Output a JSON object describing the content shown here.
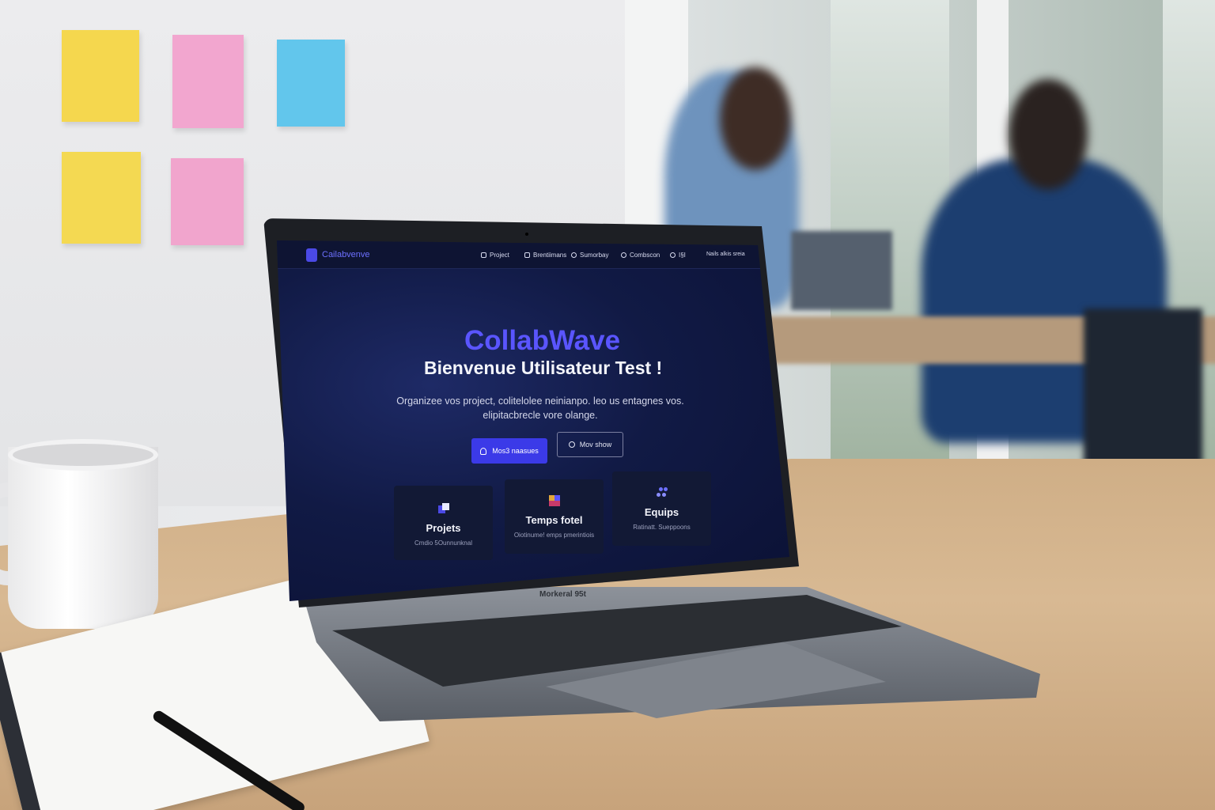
{
  "app": {
    "logo_text": "Cailabvenve",
    "brand_color": "#4b49e6"
  },
  "nav": {
    "items": [
      {
        "label": "Project",
        "icon": "user-icon"
      },
      {
        "label": "Brentiimans",
        "icon": "document-icon"
      },
      {
        "label": "Sumorbay",
        "icon": "search-icon"
      },
      {
        "label": "Combscon",
        "icon": "gear-icon"
      },
      {
        "label": "I§I",
        "icon": "search-icon"
      }
    ],
    "user_label": "Nails alkis sreia"
  },
  "hero": {
    "title": "CollabWave",
    "welcome": "Bienvenue Utilisateur Test !",
    "subtitle": "Organizee vos project, colitelolee neinianpo. leo us entagnes vos. elipitacbrecle vore olange.",
    "primary_button": "Mos3 naasues",
    "secondary_button": "Mov show"
  },
  "cards": [
    {
      "title": "Projets",
      "subtitle": "Cmdio 5Ounnunknal",
      "icon": "projects-icon"
    },
    {
      "title": "Temps fotel",
      "subtitle": "Oiotinume! emps pmerintiois",
      "icon": "time-icon"
    },
    {
      "title": "Equips",
      "subtitle": "Ratinatt. Sueppoons",
      "icon": "team-icon"
    }
  ],
  "device": {
    "base_label": "Morkeral 95t"
  }
}
